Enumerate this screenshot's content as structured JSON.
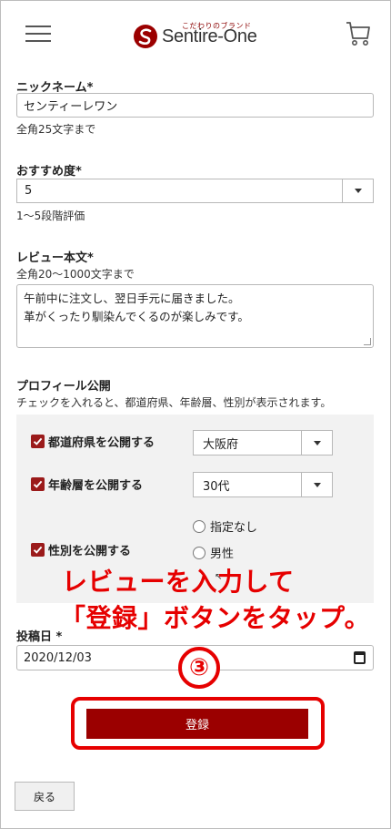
{
  "header": {
    "brand_tagline": "こだわりのブランド",
    "brand_name": "Sentire-One",
    "accent_color": "#9b0000"
  },
  "form": {
    "nickname": {
      "label": "ニックネーム*",
      "value": "センティーレワン",
      "note": "全角25文字まで"
    },
    "rating": {
      "label": "おすすめ度*",
      "selected": "5",
      "note": "1〜5段階評価"
    },
    "review": {
      "label": "レビュー本文*",
      "note": "全角20〜1000文字まで",
      "lines": [
        "午前中に注文し、翌日手元に届きました。",
        "革がくったり馴染んでくるのが楽しみです。"
      ]
    },
    "profile": {
      "label": "プロフィール公開",
      "note": "チェックを入れると、都道府県、年齢層、性別が表示されます。",
      "prefecture": {
        "label": "都道府県を公開する",
        "checked": true,
        "selected": "大阪府"
      },
      "age": {
        "label": "年齢層を公開する",
        "checked": true,
        "selected": "30代"
      },
      "gender": {
        "label": "性別を公開する",
        "checked": true,
        "options": [
          "指定なし",
          "男性"
        ]
      }
    },
    "post_date": {
      "label": "投稿日 *",
      "value": "2020/12/03"
    },
    "register_label": "登録",
    "back_label": "戻る"
  },
  "annotation": {
    "line1": "レビューを入力して",
    "line2": "「登録」ボタンをタップ。",
    "step": "③",
    "color": "#e60000"
  },
  "icons": [
    "menu-icon",
    "cart-icon",
    "chevron-down-icon",
    "check-icon",
    "calendar-icon"
  ]
}
